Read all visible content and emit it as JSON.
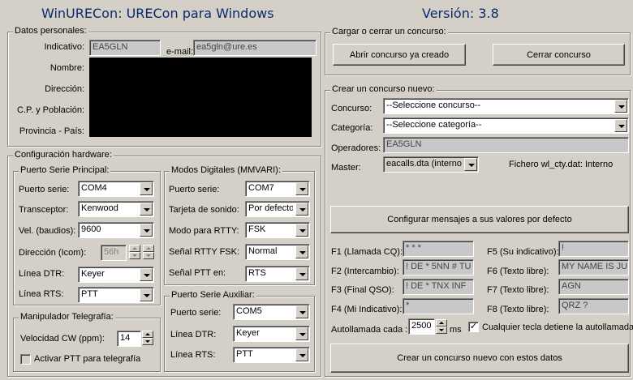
{
  "header": {
    "title": "WinURECon: URECon para Windows",
    "version": "Versión: 3.8"
  },
  "personal": {
    "legend": "Datos personales:",
    "indicativo_label": "Indicativo:",
    "indicativo_value": "EA5GLN",
    "email_label": "e-mail:",
    "email_value": "ea5gln@ure.es",
    "nombre_label": "Nombre:",
    "direccion_label": "Dirección:",
    "cp_label": "C.P. y Población:",
    "provincia_label": "Provincia - País:"
  },
  "hardware": {
    "legend": "Configuración hardware:",
    "principal": {
      "legend": "Puerto Serie Principal:",
      "puerto_label": "Puerto serie:",
      "puerto_value": "COM4",
      "transceptor_label": "Transceptor:",
      "transceptor_value": "Kenwood",
      "vel_label": "Vel. (baudios):",
      "vel_value": "9600",
      "direccion_label": "Dirección (Icom):",
      "direccion_value": "56h",
      "dtr_label": "Línea DTR:",
      "dtr_value": "Keyer",
      "rts_label": "Línea RTS:",
      "rts_value": "PTT"
    },
    "digital": {
      "legend": "Modos Digitales (MMVARI):",
      "puerto_label": "Puerto serie:",
      "puerto_value": "COM7",
      "tarjeta_label": "Tarjeta de sonido:",
      "tarjeta_value": "Por defecto",
      "rtty_label": "Modo para RTTY:",
      "rtty_value": "FSK",
      "fsk_label": "Señal RTTY FSK:",
      "fsk_value": "Normal",
      "ptt_label": "Señal PTT en:",
      "ptt_value": "RTS"
    },
    "auxiliar": {
      "legend": "Puerto Serie Auxiliar:",
      "puerto_label": "Puerto serie:",
      "puerto_value": "COM5",
      "dtr_label": "Línea DTR:",
      "dtr_value": "Keyer",
      "rts_label": "Línea RTS:",
      "rts_value": "PTT"
    },
    "telegrafia": {
      "legend": "Manipulador Telegrafía:",
      "velocidad_label": "Velocidad CW (ppm):",
      "velocidad_value": "14",
      "ptt_checkbox_label": "Activar PTT para telegrafía"
    }
  },
  "cargar": {
    "legend": "Cargar o cerrar un concurso:",
    "abrir_button": "Abrir concurso ya creado",
    "cerrar_button": "Cerrar concurso"
  },
  "crear": {
    "legend": "Crear un concurso nuevo:",
    "concurso_label": "Concurso:",
    "concurso_value": "--Seleccione concurso--",
    "categoria_label": "Categoría:",
    "categoria_value": "--Seleccione categoría--",
    "operadores_label": "Operadores:",
    "operadores_value": "EA5GLN",
    "master_label": "Master:",
    "master_value": "eacalls.dta (interno)",
    "fichero_text": "Fichero wl_cty.dat: Interno",
    "configurar_button": "Configurar mensajes a sus valores por defecto",
    "f1_label": "F1 (Llamada CQ):",
    "f1_value": "* * *",
    "f2_label": "F2 (Intercambio):",
    "f2_value": "! DE * 5NN # TU",
    "f3_label": "F3 (Final QSO):",
    "f3_value": "! DE *  TNX INF",
    "f4_label": "F4 (Mi Indicativo):",
    "f4_value": "*",
    "f5_label": "F5 (Su indicativo):",
    "f5_value": "!",
    "f6_label": "F6 (Texto libre):",
    "f6_value": "MY NAME IS JU",
    "f7_label": "F7 (Texto libre):",
    "f7_value": "AGN",
    "f8_label": "F8 (Texto libre):",
    "f8_value": "QRZ ?",
    "autollamada_label": "Autollamada cada :",
    "autollamada_value": "2500",
    "ms_label": "ms",
    "cualquier_checkbox_label": "Cualquier tecla detiene la autollamada",
    "cualquier_checked": true,
    "crear_button": "Crear un concurso nuevo con estos datos"
  }
}
